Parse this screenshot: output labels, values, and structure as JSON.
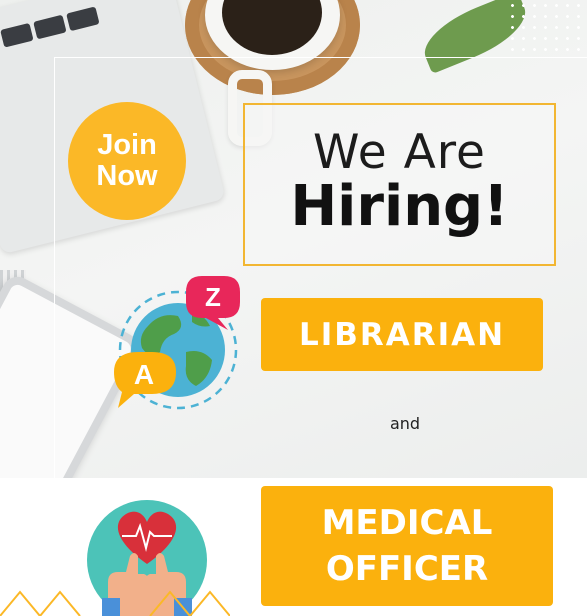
{
  "badge": {
    "line1": "Join",
    "line2": "Now"
  },
  "headline": {
    "line1": "We Are",
    "line2": "Hiring!"
  },
  "positions": {
    "first": "LIBRARIAN",
    "connector": "and",
    "second_line1": "MEDICAL",
    "second_line2": "OFFICER"
  },
  "icons": {
    "globe": "globe-language-icon",
    "letter_a": "A",
    "letter_z": "Z",
    "health": "heart-thumbs-up-icon"
  },
  "colors": {
    "accent_yellow": "#fbb10d",
    "badge_yellow": "#fbb827",
    "speech_red": "#e8275a",
    "globe_blue": "#4cb2d4",
    "globe_green": "#4f9e4a",
    "teal": "#4cc3b8",
    "heart_red": "#d8303a"
  }
}
